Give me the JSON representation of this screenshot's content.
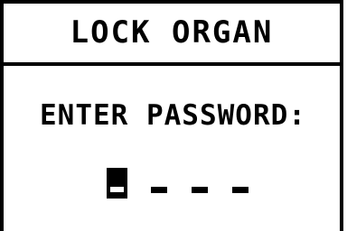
{
  "title": "LOCK ORGAN",
  "prompt": "ENTER PASSWORD:",
  "password": {
    "length": 4,
    "cursor_position": 1,
    "placeholder_char": "-"
  }
}
